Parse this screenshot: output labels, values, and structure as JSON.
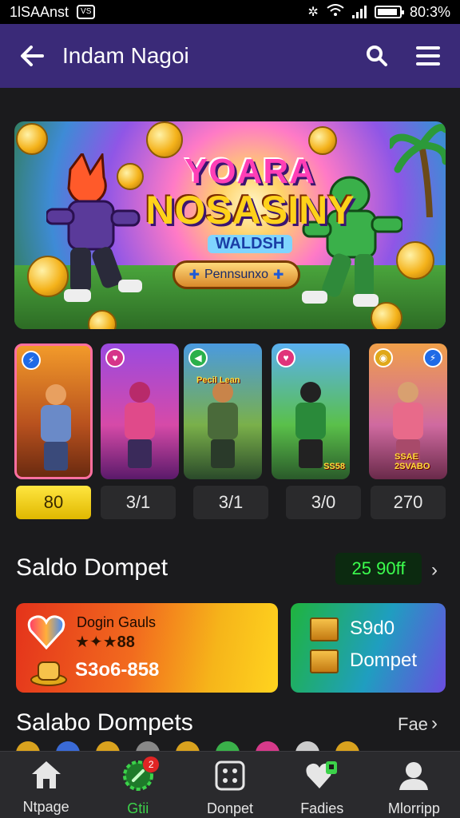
{
  "status_bar": {
    "left_text": "1lSAAnst",
    "chip": "VS",
    "battery_text": "80:3%"
  },
  "app_bar": {
    "title": "Indam Nagoi",
    "back_icon": "arrow-left-icon",
    "search_icon": "search-icon",
    "menu_icon": "menu-icon"
  },
  "banner": {
    "title_line1": "YOARA",
    "title_line2": "NOSASINY",
    "subtitle": "WALDSH",
    "pill_label": "Pennsunxo"
  },
  "characters": [
    {
      "stat": "80",
      "active": true,
      "caption": ""
    },
    {
      "stat": "3/1",
      "active": false,
      "caption": ""
    },
    {
      "stat": "3/1",
      "active": false,
      "caption": "Pecil Lean"
    },
    {
      "stat": "3/0",
      "active": false,
      "caption": "SS58"
    },
    {
      "stat": "270",
      "active": false,
      "caption": "SSAE 2SVABO"
    }
  ],
  "wallet_section": {
    "title": "Saldo Dompet",
    "amount": "25 90ff"
  },
  "wallet_card_left": {
    "title": "Dogin Gauls",
    "stars": "★✦★88",
    "range": "S3o6-858"
  },
  "wallet_card_right": {
    "line1": "S9d0",
    "line2": "Dompet"
  },
  "second_section": {
    "title": "Salabo Dompets",
    "link": "Fae"
  },
  "bottom_nav": [
    {
      "label": "Ntpage",
      "icon": "home-icon",
      "active": false
    },
    {
      "label": "Gtii",
      "icon": "game-icon",
      "active": true,
      "badge": "2"
    },
    {
      "label": "Donpet",
      "icon": "dice-icon",
      "active": false
    },
    {
      "label": "Fadies",
      "icon": "heart-icon",
      "active": false
    },
    {
      "label": "Mlorripp",
      "icon": "profile-icon",
      "active": false
    }
  ],
  "colors": {
    "app_bar": "#3a2a78",
    "accent_green": "#3cd24a",
    "active_stat": "#ffe640",
    "background": "#1b1b1d"
  }
}
